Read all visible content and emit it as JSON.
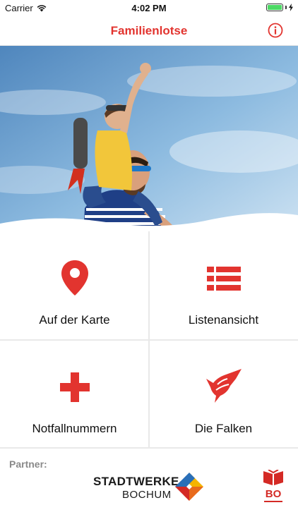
{
  "status_bar": {
    "carrier": "Carrier",
    "time": "4:02 PM"
  },
  "nav": {
    "title": "Familienlotse",
    "info_icon": "info-icon"
  },
  "tiles": [
    {
      "label": "Auf der Karte",
      "icon": "map-pin-icon"
    },
    {
      "label": "Listenansicht",
      "icon": "list-icon"
    },
    {
      "label": "Notfallnummern",
      "icon": "plus-icon"
    },
    {
      "label": "Die Falken",
      "icon": "falcon-icon"
    }
  ],
  "partners": {
    "label": "Partner:",
    "stadtwerke_line1": "STADTWERKE",
    "stadtwerke_line2": "BOCHUM",
    "bo_text": "BO"
  },
  "colors": {
    "accent": "#e2342f",
    "sky": "#7fb0d8"
  }
}
